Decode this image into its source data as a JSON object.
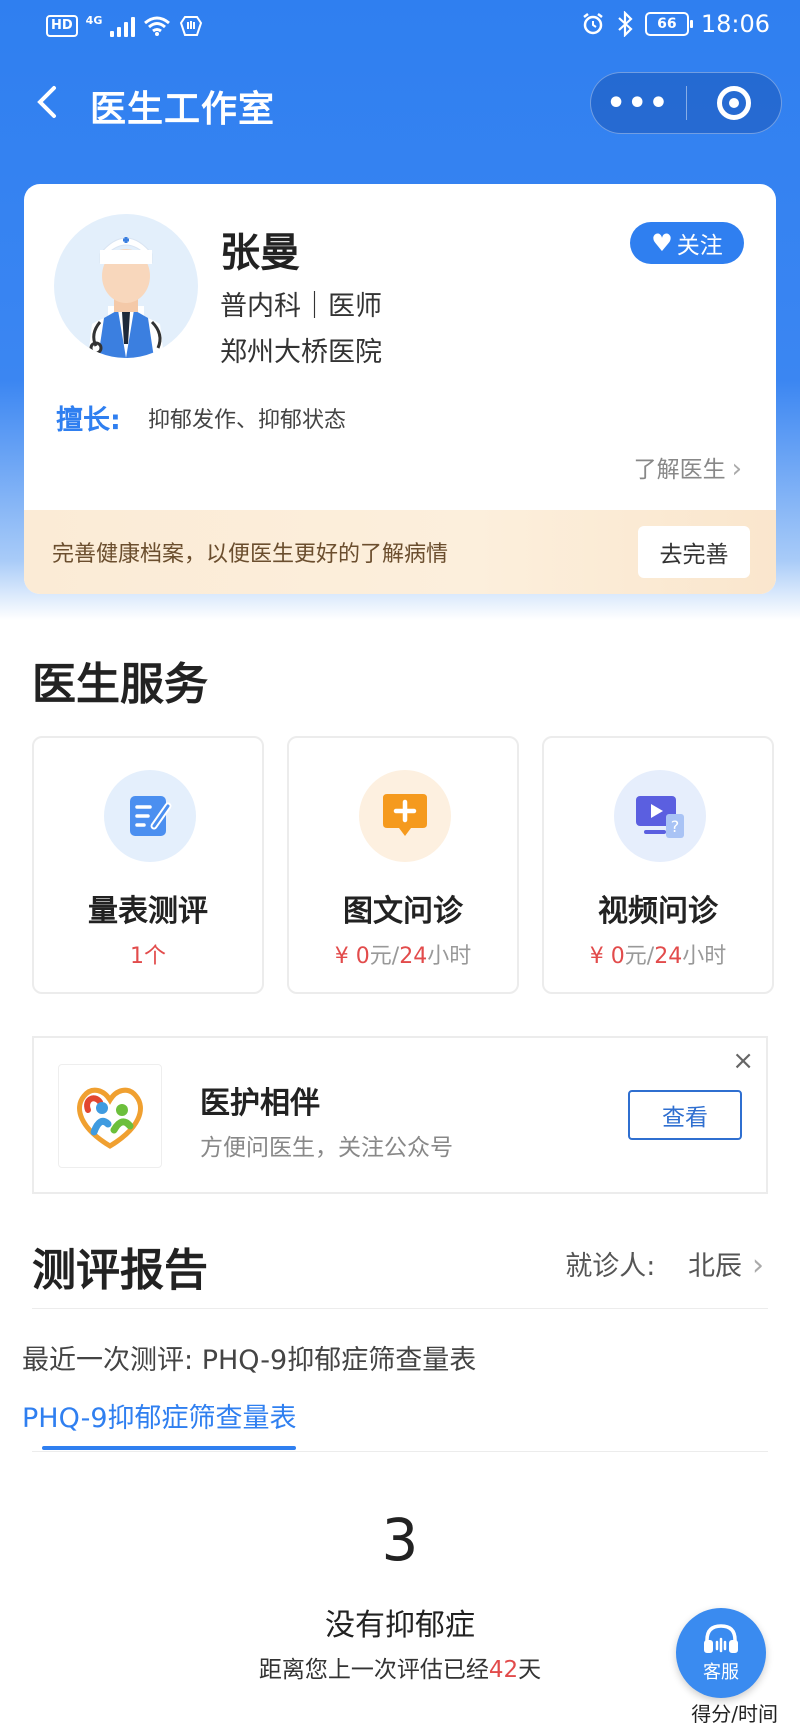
{
  "status_bar": {
    "hd": "HD",
    "network": "4G",
    "battery": "66",
    "time": "18:06"
  },
  "nav": {
    "title": "医生工作室",
    "more": "•••"
  },
  "doctor": {
    "name": "张曼",
    "dept": "普内科｜医师",
    "hospital": "郑州大桥医院",
    "follow_label": "关注",
    "specialty_label": "擅长:",
    "specialty": "抑郁发作、抑郁状态",
    "learn_more": "了解医生"
  },
  "profile_banner": {
    "text": "完善健康档案，以便医生更好的了解病情",
    "button": "去完善"
  },
  "services": {
    "title": "医生服务",
    "items": [
      {
        "name": "量表测评",
        "sub": "1个",
        "sub_color": "#e24b4b"
      },
      {
        "name": "图文问诊",
        "price": "¥ 0",
        "unit": "元/",
        "hours": "24",
        "hour_unit": "小时"
      },
      {
        "name": "视频问诊",
        "price": "¥ 0",
        "unit": "元/",
        "hours": "24",
        "hour_unit": "小时"
      }
    ]
  },
  "promo": {
    "name": "医护相伴",
    "desc": "方便问医生，关注公众号",
    "button": "查看",
    "close": "×"
  },
  "report": {
    "title": "测评报告",
    "patient_label": "就诊人:",
    "patient_name": "北辰",
    "last_eval_label": "最近一次测评:",
    "last_eval": "PHQ-9抑郁症筛查量表",
    "tab": "PHQ-9抑郁症筛查量表",
    "score": "3",
    "result": "没有抑郁症",
    "since_prefix": "距离您上一次评估已经",
    "since_days": "42",
    "since_suffix": "天"
  },
  "customer_service": {
    "label": "客服",
    "footer": "得分/时间"
  },
  "colors": {
    "brand_blue": "#2f7ff0",
    "price_red": "#e24b4b",
    "banner_bg": "#fbebd6"
  }
}
